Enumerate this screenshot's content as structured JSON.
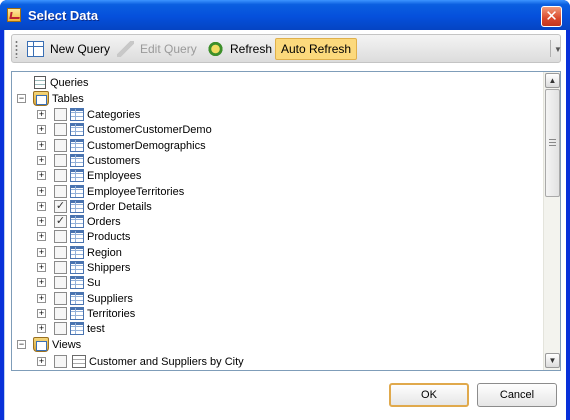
{
  "window": {
    "title": "Select Data",
    "close_glyph": "✕"
  },
  "toolbar": {
    "new_query": "New Query",
    "edit_query": "Edit Query",
    "refresh": "Refresh",
    "auto_refresh": "Auto Refresh"
  },
  "tree": {
    "queries_label": "Queries",
    "tables_label": "Tables",
    "views_label": "Views",
    "tables": [
      {
        "name": "Categories",
        "checked": false
      },
      {
        "name": "CustomerCustomerDemo",
        "checked": false
      },
      {
        "name": "CustomerDemographics",
        "checked": false
      },
      {
        "name": "Customers",
        "checked": false
      },
      {
        "name": "Employees",
        "checked": false
      },
      {
        "name": "EmployeeTerritories",
        "checked": false
      },
      {
        "name": "Order Details",
        "checked": true
      },
      {
        "name": "Orders",
        "checked": true
      },
      {
        "name": "Products",
        "checked": false
      },
      {
        "name": "Region",
        "checked": false
      },
      {
        "name": "Shippers",
        "checked": false
      },
      {
        "name": "Su",
        "checked": false
      },
      {
        "name": "Suppliers",
        "checked": false
      },
      {
        "name": "Territories",
        "checked": false
      },
      {
        "name": "test",
        "checked": false
      }
    ],
    "views": [
      {
        "name": "Customer and Suppliers by City"
      }
    ],
    "expand_glyph": "+",
    "collapse_glyph": "−",
    "check_glyph": "✓"
  },
  "buttons": {
    "ok": "OK",
    "cancel": "Cancel"
  }
}
